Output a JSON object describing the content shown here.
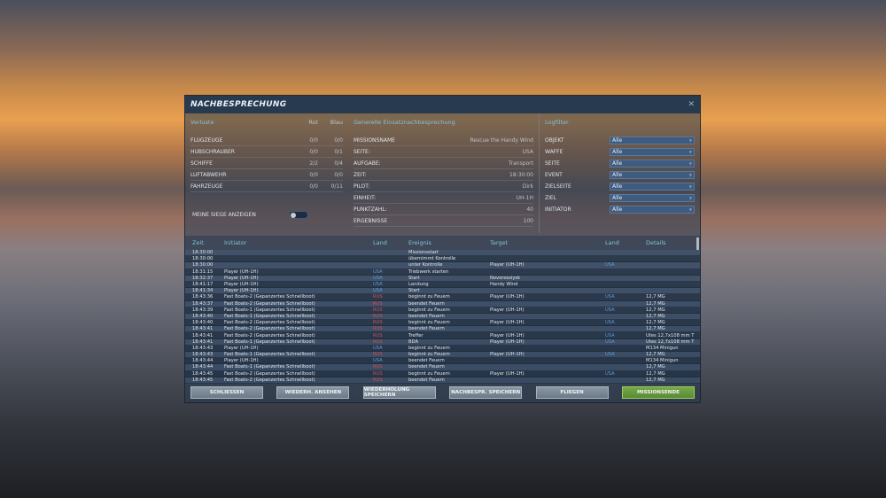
{
  "title": "NACHBESPRECHUNG",
  "losses": {
    "header": "Verluste",
    "col_red": "Rot",
    "col_blue": "Blau",
    "rows": [
      {
        "label": "FLUGZEUGE",
        "red": "0/0",
        "blue": "0/0"
      },
      {
        "label": "HUBSCHRAUBER",
        "red": "0/0",
        "blue": "0/1"
      },
      {
        "label": "SCHIFFE",
        "red": "2/2",
        "blue": "0/4"
      },
      {
        "label": "LUFTABWEHR",
        "red": "0/0",
        "blue": "0/0"
      },
      {
        "label": "FAHRZEUGE",
        "red": "0/0",
        "blue": "0/11"
      }
    ],
    "toggle_label": "MEINE SIEGE ANZEIGEN",
    "toggle_on": false
  },
  "general": {
    "header": "Generelle Einsatznachbesprechung",
    "rows": [
      {
        "label": "MISSIONSNAME",
        "value": "Rescue the Handy Wind"
      },
      {
        "label": "SEITE:",
        "value": "USA"
      },
      {
        "label": "AUFGABE:",
        "value": "Transport"
      },
      {
        "label": "ZEIT:",
        "value": "18:30:00"
      },
      {
        "label": "PILOT:",
        "value": "Dirk"
      },
      {
        "label": "EINHEIT:",
        "value": "UH-1H"
      },
      {
        "label": "PUNKTZAHL:",
        "value": "40"
      },
      {
        "label": "ERGEBNISSE",
        "value": "100"
      }
    ]
  },
  "logfilter": {
    "header": "Logfilter",
    "rows": [
      {
        "label": "OBJEKT",
        "value": "Alle"
      },
      {
        "label": "WAFFE",
        "value": "Alle"
      },
      {
        "label": "SEITE",
        "value": "Alle"
      },
      {
        "label": "EVENT",
        "value": "Alle"
      },
      {
        "label": "ZIELSEITE",
        "value": "Alle"
      },
      {
        "label": "ZIEL",
        "value": "Alle"
      },
      {
        "label": "INITIATOR",
        "value": "Alle"
      }
    ]
  },
  "log": {
    "columns": [
      "Zeit",
      "Initiator",
      "Land",
      "Ereignis",
      "Target",
      "Land",
      "Details"
    ],
    "rows": [
      [
        "18:30:00",
        "",
        "",
        "Missionsstart",
        "",
        "",
        ""
      ],
      [
        "18:30:00",
        "",
        "",
        "übernimmt Kontrolle",
        "",
        "",
        ""
      ],
      [
        "18:30:00",
        "",
        "",
        "unter Kontrolle",
        "Player (UH-1H)",
        "USA",
        ""
      ],
      [
        "18:31:15",
        "Player (UH-1H)",
        "USA",
        "Triebwerk starten",
        "",
        "",
        ""
      ],
      [
        "18:32:37",
        "Player (UH-1H)",
        "USA",
        "Start",
        "Novorossiysk",
        "",
        ""
      ],
      [
        "18:41:17",
        "Player (UH-1H)",
        "USA",
        "Landung",
        "Handy Wind",
        "",
        ""
      ],
      [
        "18:41:34",
        "Player (UH-1H)",
        "USA",
        "Start",
        "",
        "",
        ""
      ],
      [
        "18:43:36",
        "Fast Boats-2 (Gepanzertes Schnellboot)",
        "RUS",
        "beginnt zu Feuern",
        "Player (UH-1H)",
        "USA",
        "12,7 MG"
      ],
      [
        "18:43:37",
        "Fast Boats-2 (Gepanzertes Schnellboot)",
        "RUS",
        "beendet Feuern",
        "",
        "",
        "12,7 MG"
      ],
      [
        "18:43:39",
        "Fast Boats-1 (Gepanzertes Schnellboot)",
        "RUS",
        "beginnt zu Feuern",
        "Player (UH-1H)",
        "USA",
        "12,7 MG"
      ],
      [
        "18:43:40",
        "Fast Boats-1 (Gepanzertes Schnellboot)",
        "RUS",
        "beendet Feuern",
        "",
        "",
        "12,7 MG"
      ],
      [
        "18:43:40",
        "Fast Boats-2 (Gepanzertes Schnellboot)",
        "RUS",
        "beginnt zu Feuern",
        "Player (UH-1H)",
        "USA",
        "12,7 MG"
      ],
      [
        "18:43:41",
        "Fast Boats-2 (Gepanzertes Schnellboot)",
        "RUS",
        "beendet Feuern",
        "",
        "",
        "12,7 MG"
      ],
      [
        "18:43:41",
        "Fast Boats-2 (Gepanzertes Schnellboot)",
        "RUS",
        "Treffer",
        "Player (UH-1H)",
        "USA",
        "Utes 12,7x108 mm T"
      ],
      [
        "18:43:41",
        "Fast Boats-1 (Gepanzertes Schnellboot)",
        "RUS",
        "BDA",
        "Player (UH-1H)",
        "USA",
        "Utes 12,7x108 mm T"
      ],
      [
        "18:43:43",
        "Player (UH-1H)",
        "USA",
        "beginnt zu Feuern",
        "",
        "",
        "M134 Minigun"
      ],
      [
        "18:43:43",
        "Fast Boats-1 (Gepanzertes Schnellboot)",
        "RUS",
        "beginnt zu Feuern",
        "Player (UH-1H)",
        "USA",
        "12,7 MG"
      ],
      [
        "18:43:44",
        "Player (UH-1H)",
        "USA",
        "beendet Feuern",
        "",
        "",
        "M134 Minigun"
      ],
      [
        "18:43:44",
        "Fast Boats-1 (Gepanzertes Schnellboot)",
        "RUS",
        "beendet Feuern",
        "",
        "",
        "12,7 MG"
      ],
      [
        "18:43:45",
        "Fast Boats-2 (Gepanzertes Schnellboot)",
        "RUS",
        "beginnt zu Feuern",
        "Player (UH-1H)",
        "USA",
        "12,7 MG"
      ],
      [
        "18:43:45",
        "Fast Boats-2 (Gepanzertes Schnellboot)",
        "RUS",
        "beendet Feuern",
        "",
        "",
        "12,7 MG"
      ]
    ]
  },
  "buttons": {
    "close": "SCHLIESSEN",
    "replay": "WIEDERH. ANSEHEN",
    "save_replay": "WIEDERHOLUNG SPEICHERN",
    "save_debrief": "NACHBESPR. SPEICHERN",
    "fly": "FLIEGEN",
    "end": "MISSIONSENDE"
  },
  "colors": {
    "usa": "#5a9ad8",
    "rus": "#d05050",
    "accent": "#7fc3d8",
    "end_button": "#6a9a3e"
  }
}
